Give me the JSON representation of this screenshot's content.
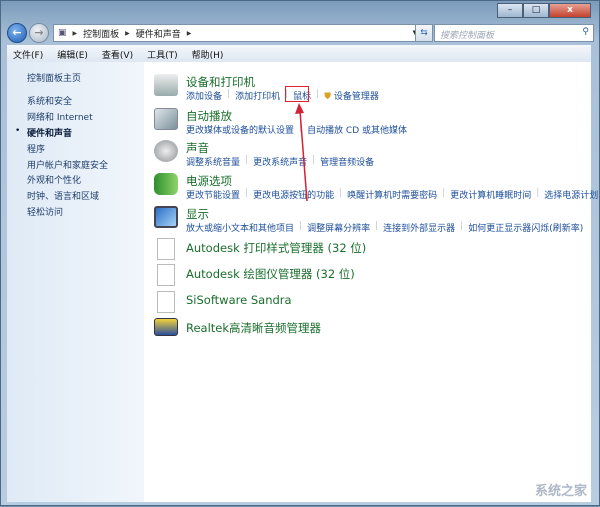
{
  "window": {
    "minimize": "–",
    "maximize": "□",
    "close": "x"
  },
  "breadcrumb": [
    "控制面板",
    "硬件和声音"
  ],
  "search": {
    "placeholder": "搜索控制面板"
  },
  "menu": [
    "文件(F)",
    "编辑(E)",
    "查看(V)",
    "工具(T)",
    "帮助(H)"
  ],
  "sidebar": {
    "home": "控制面板主页",
    "items": [
      "系统和安全",
      "网络和 Internet",
      "硬件和声音",
      "程序",
      "用户帐户和家庭安全",
      "外观和个性化",
      "时钟、语言和区域",
      "轻松访问"
    ],
    "current": "硬件和声音"
  },
  "categories": [
    {
      "title": "设备和打印机",
      "icon": "printer-icon",
      "links": [
        "添加设备",
        "添加打印机",
        "鼠标",
        "设备管理器"
      ]
    },
    {
      "title": "自动播放",
      "icon": "autoplay-icon",
      "links": [
        "更改媒体或设备的默认设置",
        "自动播放 CD 或其他媒体"
      ]
    },
    {
      "title": "声音",
      "icon": "speaker-icon",
      "links": [
        "调整系统音量",
        "更改系统声音",
        "管理音频设备"
      ]
    },
    {
      "title": "电源选项",
      "icon": "battery-icon",
      "links": [
        "更改节能设置",
        "更改电源按钮的功能",
        "唤醒计算机时需要密码",
        "更改计算机睡眠时间",
        "选择电源计划"
      ]
    },
    {
      "title": "显示",
      "icon": "monitor-icon",
      "links": [
        "放大或缩小文本和其他项目",
        "调整屏幕分辨率",
        "连接到外部显示器",
        "如何更正显示器闪烁(刷新率)"
      ]
    }
  ],
  "programs": [
    {
      "title": "Autodesk 打印样式管理器 (32 位)",
      "icon": "document-icon"
    },
    {
      "title": "Autodesk 绘图仪管理器 (32 位)",
      "icon": "document-icon"
    },
    {
      "title": "SiSoftware Sandra",
      "icon": "document-icon"
    },
    {
      "title": "Realtek高清晰音频管理器",
      "icon": "realtek-audio-icon"
    }
  ],
  "watermark": "系统之家",
  "colors": {
    "link": "#1e4f9a",
    "title": "#1a6e2c",
    "highlight": "#d22233"
  }
}
